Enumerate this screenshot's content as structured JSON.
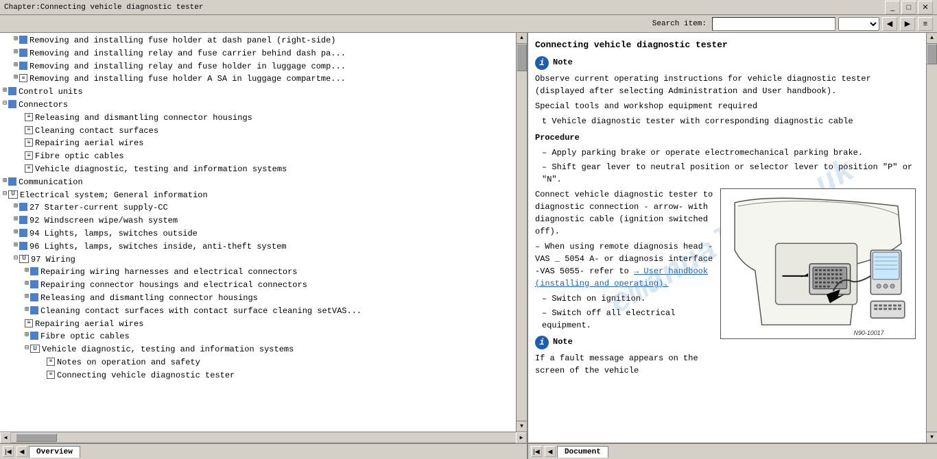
{
  "titlebar": {
    "title": "Chapter:Connecting vehicle diagnostic tester"
  },
  "toolbar": {
    "search_label": "Search item:",
    "search_placeholder": ""
  },
  "left_panel": {
    "tree_items": [
      {
        "level": 1,
        "icon": "expand",
        "type": "page",
        "text": "Removing and installing fuse holder at dash panel (right-side)"
      },
      {
        "level": 1,
        "icon": "expand",
        "type": "blue",
        "text": "Removing and installing relay and fuse carrier behind dash pa..."
      },
      {
        "level": 1,
        "icon": "expand",
        "type": "blue",
        "text": "Removing and installing relay and fuse holder in luggage comp..."
      },
      {
        "level": 1,
        "icon": "expand",
        "type": "page",
        "text": "Removing and installing fuse holder A SA in luggage compartme..."
      },
      {
        "level": 0,
        "icon": "expand-plus",
        "type": "blue",
        "text": "Control units"
      },
      {
        "level": 0,
        "icon": "expand-minus",
        "type": "blue",
        "text": "Connectors"
      },
      {
        "level": 1,
        "icon": "none",
        "type": "page",
        "text": "Releasing and dismantling connector housings"
      },
      {
        "level": 1,
        "icon": "none",
        "type": "page",
        "text": "Cleaning contact surfaces"
      },
      {
        "level": 1,
        "icon": "none",
        "type": "page",
        "text": "Repairing aerial wires"
      },
      {
        "level": 1,
        "icon": "none",
        "type": "page",
        "text": "Fibre optic cables"
      },
      {
        "level": 1,
        "icon": "none",
        "type": "page",
        "text": "Vehicle diagnostic, testing and information systems"
      },
      {
        "level": 0,
        "icon": "expand-plus",
        "type": "blue",
        "text": "Communication"
      },
      {
        "level": 0,
        "icon": "none",
        "type": "text",
        "text": "Electrical system; General information"
      },
      {
        "level": 0,
        "icon": "expand-minus",
        "type": "blue-open",
        "text": "Electrical system; General information"
      },
      {
        "level": 1,
        "icon": "expand-plus",
        "type": "blue",
        "text": "27 Starter-current supply-CC"
      },
      {
        "level": 1,
        "icon": "expand-plus",
        "type": "blue",
        "text": "92 Windscreen wipe/wash system"
      },
      {
        "level": 1,
        "icon": "expand-plus",
        "type": "blue",
        "text": "94 Lights, lamps, switches outside"
      },
      {
        "level": 1,
        "icon": "expand-plus",
        "type": "blue",
        "text": "96 Lights, lamps, switches inside, anti-theft system"
      },
      {
        "level": 1,
        "icon": "expand-minus",
        "type": "blue-open",
        "text": "97 Wiring"
      },
      {
        "level": 2,
        "icon": "expand-plus",
        "type": "blue",
        "text": "Repairing wiring harnesses and electrical connectors"
      },
      {
        "level": 2,
        "icon": "expand-plus",
        "type": "blue",
        "text": "Repairing connector housings and electrical connectors"
      },
      {
        "level": 2,
        "icon": "expand-plus",
        "type": "blue",
        "text": "Releasing and dismantling connector housings"
      },
      {
        "level": 2,
        "icon": "expand-plus",
        "type": "blue",
        "text": "Cleaning contact surfaces with contact surface cleaning setVAS..."
      },
      {
        "level": 2,
        "icon": "none",
        "type": "page",
        "text": "Repairing aerial wires"
      },
      {
        "level": 2,
        "icon": "expand-plus",
        "type": "blue",
        "text": "Fibre optic cables"
      },
      {
        "level": 2,
        "icon": "expand-minus",
        "type": "blue-open",
        "text": "Vehicle diagnostic, testing and information systems"
      },
      {
        "level": 3,
        "icon": "none",
        "type": "page",
        "text": "Notes on operation and safety"
      },
      {
        "level": 3,
        "icon": "none",
        "type": "page",
        "text": "Connecting vehicle diagnostic tester"
      }
    ]
  },
  "right_panel": {
    "doc_title": "Connecting vehicle diagnostic tester",
    "note1_label": "Note",
    "note1_text": "Observe current operating instructions for vehicle diagnostic tester (displayed after selecting Administration and User handbook).",
    "special_tools": "Special tools and workshop equipment required",
    "tool_item": "t  Vehicle diagnostic tester with corresponding diagnostic cable",
    "procedure": "Procedure",
    "steps": [
      "Apply parking brake or operate electromechanical parking brake.",
      "Shift gear lever to neutral position or selector lever to position \"P\" or \"N\".",
      "Connect vehicle diagnostic tester to diagnostic connection - arrow- with diagnostic cable (ignition switched off).",
      "When using remote diagnosis head -VAS _ 5054 A- or diagnosis interface -VAS 5055- refer to",
      "Switch on ignition.",
      "Switch off all electrical equipment."
    ],
    "link_text": "→ User handbook (installing and operating).",
    "note2_label": "Note",
    "note2_text": "If a fault message appears on the screen of the vehicle",
    "connect_text1": "Connect vehicle",
    "connect_text2": "diagnostic tester to",
    "connect_text3": "diagnostic connection -",
    "connect_text4": "arrow- with diagnostic",
    "connect_text5": "cable (ignition switched",
    "connect_text6": "off).",
    "remote_text1": "When using remote",
    "remote_text2": "diagnosis head -VAS",
    "remote_text3": "_ 5054 A- or diagnosis",
    "remote_text4": "interface -VAS 5055-",
    "remote_text5": "refer to",
    "diagram_label": "N90-10017",
    "arrow_label": "arrow - With diagnostic"
  },
  "bottom": {
    "left_tab": "Overview",
    "right_tab": "Document"
  }
}
